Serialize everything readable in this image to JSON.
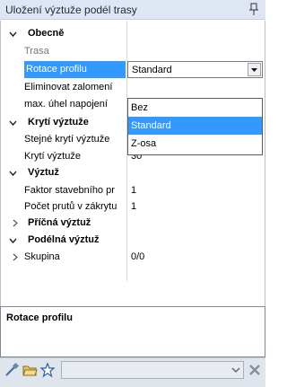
{
  "window": {
    "title": "Uložení výztuže podél trasy"
  },
  "sections": [
    {
      "label": "Obecně"
    },
    {
      "label": "Krytí výztuže"
    },
    {
      "label": "Výztuž"
    },
    {
      "label": "Příčná výztuž"
    },
    {
      "label": "Podélná výztuž"
    }
  ],
  "properties": {
    "trasa": {
      "label": "Trasa"
    },
    "rotace": {
      "label": "Rotace profilu",
      "value": "Standard"
    },
    "eliminovat": {
      "label": "Eliminovat zalomení"
    },
    "max_uhel": {
      "label": "max. úhel napojení"
    },
    "stejne_kryti": {
      "label": "Stejné krytí výztuže",
      "checked": true
    },
    "kryti": {
      "label": "Krytí výztuže",
      "value": "30"
    },
    "faktor": {
      "label": "Faktor stavebního pr",
      "value": "1"
    },
    "pocet": {
      "label": "Počet prutů v zákrytu",
      "value": "1"
    },
    "skupina": {
      "label": "Skupina",
      "value": "0/0"
    }
  },
  "dropdown": {
    "options": [
      "Bez",
      "Standard",
      "Z-osa"
    ],
    "selected": "Standard"
  },
  "description": {
    "title": "Rotace profilu",
    "text": ""
  },
  "icons": [
    "pin-icon",
    "eyedropper-icon",
    "open-folder-icon",
    "favorite-star-icon",
    "close-x-icon"
  ],
  "colors": {
    "selection": "#3399ff",
    "title_bar": "#dde6f2",
    "toolbar": "#dfe5ec"
  }
}
